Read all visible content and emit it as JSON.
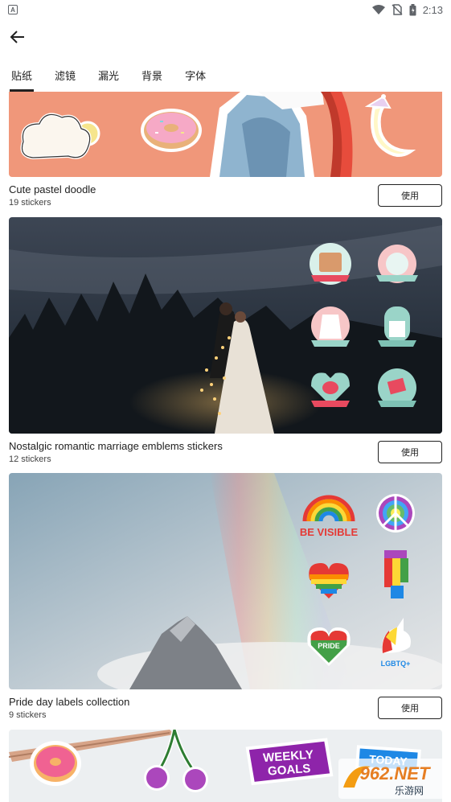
{
  "status": {
    "left_icon": "a-notification-icon",
    "time": "2:13"
  },
  "tabs": [
    {
      "label": "贴纸",
      "active": true
    },
    {
      "label": "滤镜",
      "active": false
    },
    {
      "label": "漏光",
      "active": false
    },
    {
      "label": "背景",
      "active": false
    },
    {
      "label": "字体",
      "active": false
    }
  ],
  "packs": [
    {
      "title": "Cute pastel doodle",
      "count": "19 stickers",
      "button": "使用"
    },
    {
      "title": "Nostalgic romantic marriage emblems stickers",
      "count": "12 stickers",
      "button": "使用"
    },
    {
      "title": "Pride day labels collection",
      "count": "9 stickers",
      "button": "使用"
    }
  ],
  "stickers": {
    "be_visible": "BE VISIBLE",
    "pride": "PRIDE",
    "lgbtq": "LGBTQ+",
    "weekly_goals_1": "WEEKLY",
    "weekly_goals_2": "GOALS",
    "today": "TODAY"
  },
  "watermark": {
    "main": "962.NET",
    "sub": "乐游网"
  }
}
